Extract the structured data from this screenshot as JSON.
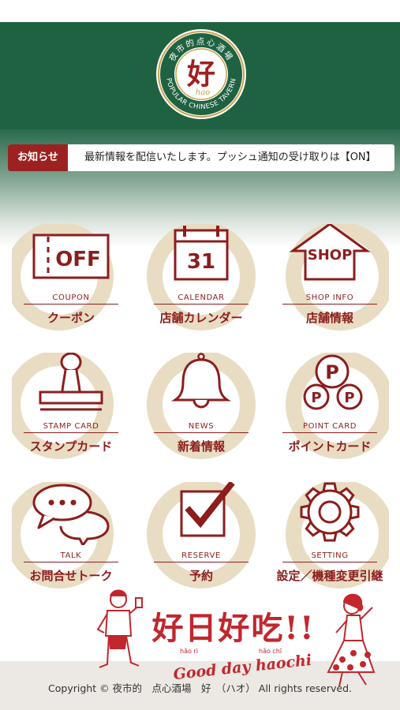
{
  "brand": {
    "logo_char": "好",
    "logo_romaji": "hao",
    "logo_top_text": "夜市的点心酒場",
    "logo_bottom_text": "POPULAR CHINESE TAVERN"
  },
  "notice": {
    "tag": "お知らせ",
    "text": "最新情報を配信いたします。プッシュ通知の受け取りは【ON】"
  },
  "menu": [
    {
      "en": "COUPON",
      "jp": "クーポン",
      "icon_text": "OFF",
      "icon": "coupon-icon"
    },
    {
      "en": "CALENDAR",
      "jp": "店舗カレンダー",
      "icon_text": "31",
      "icon": "calendar-icon"
    },
    {
      "en": "SHOP INFO",
      "jp": "店舗情報",
      "icon_text": "SHOP",
      "icon": "shop-icon"
    },
    {
      "en": "STAMP CARD",
      "jp": "スタンプカード",
      "icon": "stamp-icon"
    },
    {
      "en": "NEWS",
      "jp": "新着情報",
      "icon": "bell-icon"
    },
    {
      "en": "POINT CARD",
      "jp": "ポイントカード",
      "icon_text": "P",
      "icon": "point-icon"
    },
    {
      "en": "TALK",
      "jp": "お問合せトーク",
      "icon": "chat-icon"
    },
    {
      "en": "RESERVE",
      "jp": "予約",
      "icon": "checkbox-icon"
    },
    {
      "en": "SETTING",
      "jp": "設定／機種変更引継",
      "icon": "gear-icon"
    }
  ],
  "banner": {
    "title": "好日好吃!!",
    "subtitle": "Good day haochi",
    "pinyin_left": "hǎo rì",
    "pinyin_right": "hǎo chī"
  },
  "footer": {
    "copyright": "Copyright © 夜市的　点心酒場　好　（ハオ）  All rights reserved."
  },
  "colors": {
    "header_green": "#1f6242",
    "accent_red": "#8c1d1d",
    "tile_circle": "#e8dcc3"
  }
}
